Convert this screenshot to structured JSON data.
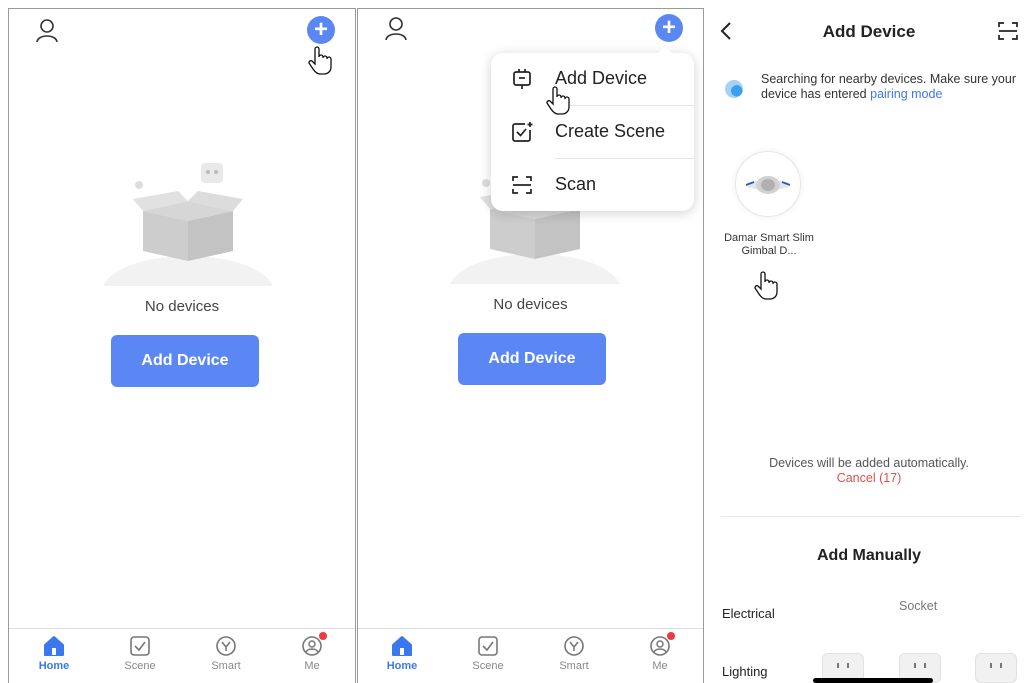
{
  "panel1": {
    "empty_text": "No devices",
    "add_button": "Add Device",
    "tabs": [
      {
        "label": "Home",
        "icon": "home-icon",
        "active": true
      },
      {
        "label": "Scene",
        "icon": "scene-icon",
        "active": false
      },
      {
        "label": "Smart",
        "icon": "smart-icon",
        "active": false
      },
      {
        "label": "Me",
        "icon": "me-icon",
        "active": false
      }
    ]
  },
  "panel2": {
    "empty_text": "No devices",
    "add_button": "Add Device",
    "menu": [
      {
        "label": "Add Device",
        "icon": "add-device-icon"
      },
      {
        "label": "Create Scene",
        "icon": "create-scene-icon"
      },
      {
        "label": "Scan",
        "icon": "scan-icon"
      }
    ],
    "tabs": [
      {
        "label": "Home",
        "icon": "home-icon",
        "active": true
      },
      {
        "label": "Scene",
        "icon": "scene-icon",
        "active": false
      },
      {
        "label": "Smart",
        "icon": "smart-icon",
        "active": false
      },
      {
        "label": "Me",
        "icon": "me-icon",
        "active": false
      }
    ]
  },
  "panel3": {
    "title": "Add Device",
    "search_text": "Searching for nearby devices. Make sure your device has entered",
    "search_link": "pairing mode",
    "device_name": "Damar Smart Slim Gimbal D...",
    "auto_text": "Devices will be added automatically.",
    "cancel_text": "Cancel (17)",
    "manual_title": "Add Manually",
    "categories": [
      "Electrical",
      "Lighting"
    ],
    "socket_label": "Socket"
  },
  "colors": {
    "accent": "#5b87f5",
    "active_tab": "#3b78f0",
    "cancel": "#e34c4c",
    "badge": "#ee3a3a"
  }
}
